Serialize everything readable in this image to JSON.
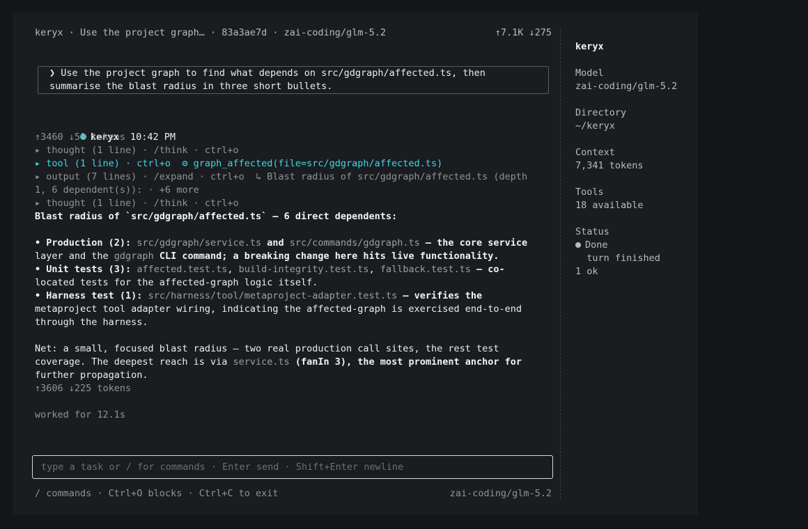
{
  "header": {
    "app": "keryx",
    "sep": " · ",
    "task": "Use the project graph…",
    "hash": "83a3ae7d",
    "model": "zai-coding/glm-5.2",
    "tokens": "↑7.1K ↓275"
  },
  "prompt": {
    "glyph": "❯",
    "line1": "Use the project graph to find what depends on src/gdgraph/affected.ts, then",
    "line2": "summarise the blast radius in three short bullets."
  },
  "message": {
    "author": "keryx",
    "time": "10:42 PM",
    "tokens_in": "↑3460 ↓50 tokens",
    "blocks": [
      "▸ thought (1 line) · /think · ctrl+o",
      "▸ tool (1 line) · ctrl+o  ⚙ graph_affected(file=src/gdgraph/affected.ts)",
      "▸ output (7 lines) · /expand · ctrl+o  ↳ Blast radius of src/gdgraph/affected.ts (depth",
      "1, 6 dependent(s)): · +6 more",
      "▸ thought (1 line) · /think · ctrl+o"
    ],
    "summary_heading": "Blast radius of `src/gdgraph/affected.ts` — 6 direct dependents:",
    "bullets": {
      "b1_label": "• Production (2):",
      "b1_code1": "src/gdgraph/service.ts",
      "b1_and": " and ",
      "b1_code2": "src/commands/gdgraph.ts",
      "b1_rest1": " — the core service",
      "b1_line2_a": "layer and the ",
      "b1_code3": "gdgraph",
      "b1_line2_b": " CLI command; a breaking change here hits live functionality.",
      "b2_label": "• Unit tests (3):",
      "b2_code1": "affected.test.ts",
      "b2_comma1": ", ",
      "b2_code2": "build-integrity.test.ts",
      "b2_comma2": ", ",
      "b2_code3": "fallback.test.ts",
      "b2_rest": " — co-",
      "b2_line2": "located tests for the affected-graph logic itself.",
      "b3_label": "• Harness test (1):",
      "b3_code": "src/harness/tool/metaproject-adapter.test.ts",
      "b3_rest": " — verifies the",
      "b3_line2": "metaproject tool adapter wiring, indicating the affected-graph is exercised end-to-end",
      "b3_line3": "through the harness."
    },
    "net": {
      "line1": "Net: a small, focused blast radius — two real production call sites, the rest test",
      "line2_a": "coverage. The deepest reach is via ",
      "line2_code": "service.ts",
      "line2_b": " (fanIn 3), the most prominent anchor for",
      "line3": "further propagation."
    },
    "tokens_out": "↑3606 ↓225 tokens",
    "worked": "worked for 12.1s"
  },
  "input": {
    "placeholder": "type a task or / for commands · Enter send · Shift+Enter newline"
  },
  "footer": {
    "hints": "/ commands · Ctrl+O blocks · Ctrl+C to exit",
    "model": "zai-coding/glm-5.2"
  },
  "sidebar": {
    "title": "keryx",
    "model_label": "Model",
    "model_value": "zai-coding/glm-5.2",
    "dir_label": "Directory",
    "dir_value": "~/keryx",
    "context_label": "Context",
    "context_value": "7,341 tokens",
    "tools_label": "Tools",
    "tools_value": "18 available",
    "status_label": "Status",
    "status_value": "Done",
    "status_detail": "  turn finished",
    "status_ok": "1 ok"
  },
  "colors": {
    "accent": "#3cd8e4",
    "background": "#1a1c20",
    "status_dot": "#b8bcc2"
  }
}
